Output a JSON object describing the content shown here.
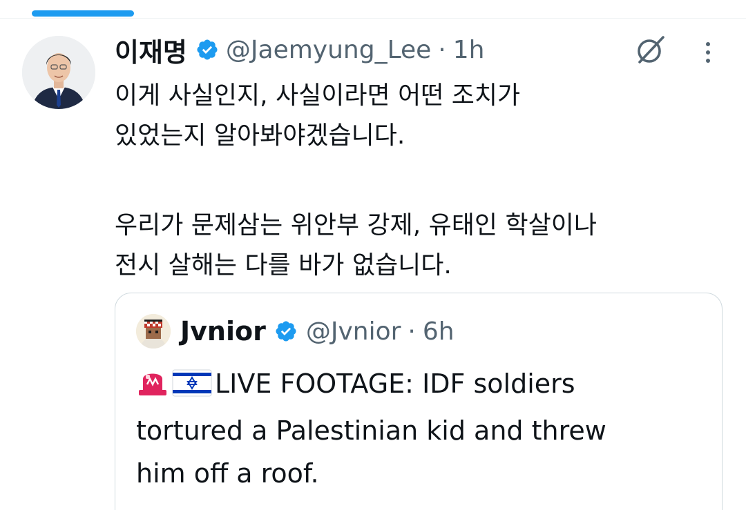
{
  "tweet": {
    "author_name": "이재명",
    "author_handle": "@Jaemyung_Lee",
    "separator": "·",
    "time": "1h",
    "body_line1": "이게 사실인지, 사실이라면 어떤 조치가",
    "body_line2": "있었는지 알아봐야겠습니다.",
    "body_line3": "우리가 문제삼는 위안부 강제, 유태인 학살이나",
    "body_line4": "전시 살해는 다를 바가 없습니다.",
    "verified_icon": "verified-badge-icon",
    "grok_icon": "grok-icon",
    "more_icon": "more-vertical-icon"
  },
  "quoted_tweet": {
    "author_name": "Jvnior",
    "author_handle": "@Jvnior",
    "separator": "·",
    "time": "6h",
    "emoji_1": "rotating-light-icon",
    "emoji_2": "israel-flag-icon",
    "body_line1": "LIVE FOOTAGE: IDF soldiers",
    "body_line2": "tortured a Palestinian kid and threw",
    "body_line3": "him off a roof."
  },
  "colors": {
    "accent": "#1d9bf0",
    "text_primary": "#0f1419",
    "text_secondary": "#536471",
    "border": "#cfd9de"
  }
}
